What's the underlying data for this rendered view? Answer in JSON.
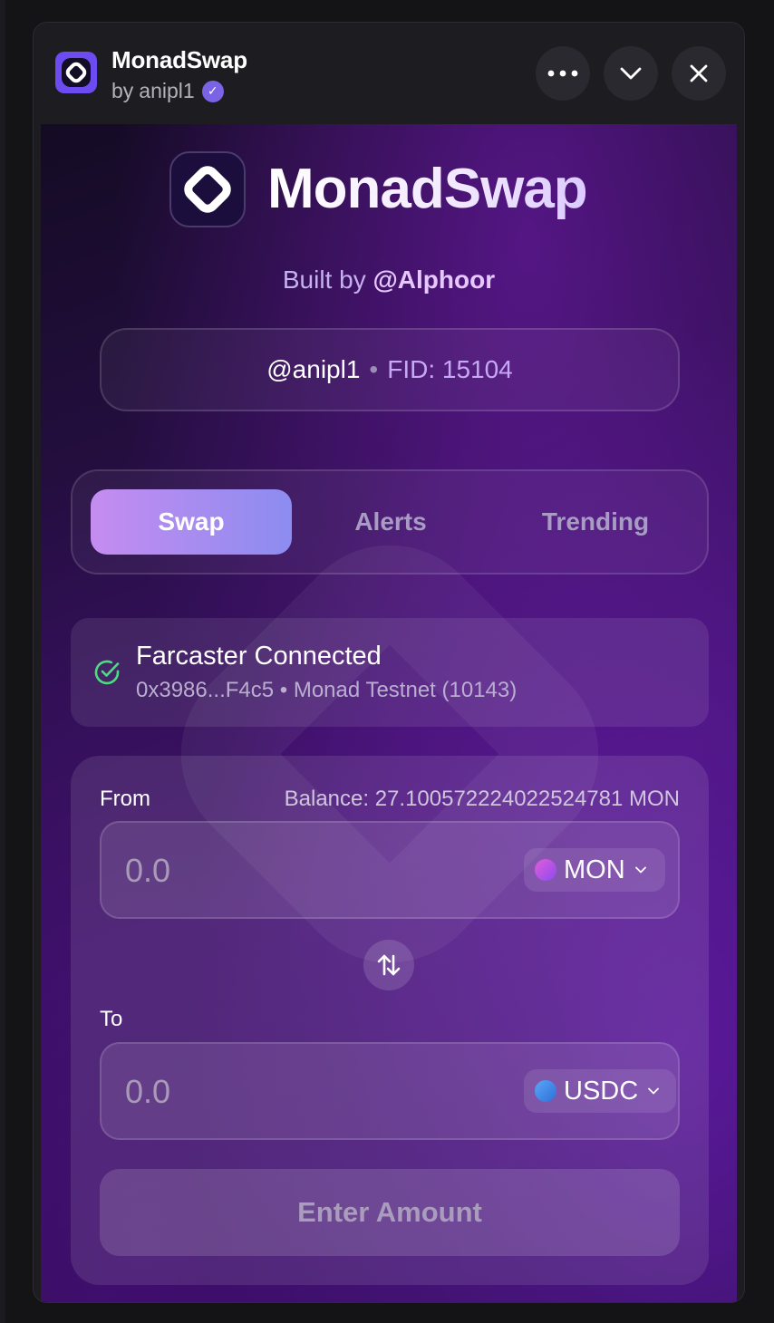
{
  "header": {
    "app_title": "MonadSwap",
    "author_prefix": "by",
    "author": "anipl1",
    "verified_icon": "verified-check-icon",
    "more_icon": "ellipsis-icon",
    "collapse_icon": "chevron-down-icon",
    "close_icon": "close-icon"
  },
  "brand": {
    "name": "MonadSwap",
    "built_by_prefix": "Built by",
    "built_by_handle": "@Alphoor"
  },
  "user": {
    "username": "@anipl1",
    "separator": "•",
    "fid": "FID: 15104"
  },
  "tabs": [
    {
      "label": "Swap",
      "active": true
    },
    {
      "label": "Alerts",
      "active": false
    },
    {
      "label": "Trending",
      "active": false
    }
  ],
  "status": {
    "title": "Farcaster Connected",
    "subtitle": "0x3986...F4c5 • Monad Testnet (10143)",
    "color": "#4ade80"
  },
  "swap": {
    "from_label": "From",
    "balance": "Balance: 27.100572224022524781 MON",
    "from_placeholder": "0.0",
    "from_token": "MON",
    "to_label": "To",
    "to_placeholder": "0.0",
    "to_token": "USDC",
    "submit_label": "Enter Amount"
  },
  "colors": {
    "accent_gradient_start": "#c58cf0",
    "accent_gradient_end": "#8c8cf0",
    "background": "#2a0f4a"
  }
}
